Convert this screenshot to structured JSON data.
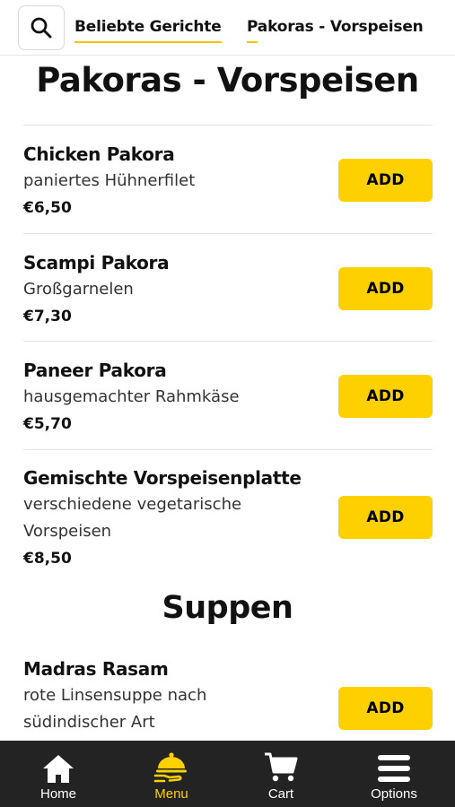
{
  "header": {
    "tabs": [
      {
        "label": "Beliebte Gerichte"
      },
      {
        "label": "Pakoras - Vorspeisen"
      }
    ]
  },
  "sections": [
    {
      "title": "Pakoras - Vorspeisen",
      "items": [
        {
          "name": "Chicken Pakora",
          "description": "paniertes Hühnerfilet",
          "price": "€6,50",
          "button": "ADD"
        },
        {
          "name": "Scampi Pakora",
          "description": "Großgarnelen",
          "price": "€7,30",
          "button": "ADD"
        },
        {
          "name": "Paneer Pakora",
          "description": "hausgemachter Rahmkäse",
          "price": "€5,70",
          "button": "ADD"
        },
        {
          "name": "Gemischte Vorspeisenplatte",
          "description": "verschiedene vegetarische Vorspeisen",
          "price": "€8,50",
          "button": "ADD"
        }
      ]
    },
    {
      "title": "Suppen",
      "items": [
        {
          "name": "Madras Rasam",
          "description": "rote Linsensuppe nach südindischer Art",
          "button": "ADD"
        }
      ]
    }
  ],
  "bottom_nav": {
    "items": [
      {
        "label": "Home",
        "icon": "home-icon"
      },
      {
        "label": "Menu",
        "icon": "menu-cloche-icon",
        "active": true
      },
      {
        "label": "Cart",
        "icon": "cart-icon"
      },
      {
        "label": "Options",
        "icon": "hamburger-icon"
      }
    ]
  },
  "colors": {
    "accent": "#ffd000",
    "nav_background": "#232323",
    "text": "#111111"
  }
}
